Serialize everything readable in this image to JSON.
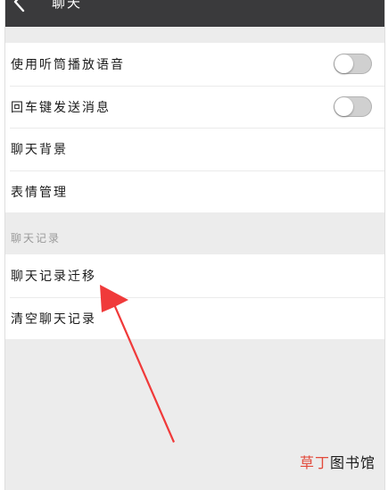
{
  "header": {
    "title": "聊天",
    "back_icon": "chevron-left-icon"
  },
  "settings": {
    "group1": [
      {
        "label": "使用听筒播放语音",
        "type": "toggle",
        "on": false
      },
      {
        "label": "回车键发送消息",
        "type": "toggle",
        "on": false
      },
      {
        "label": "聊天背景",
        "type": "link"
      },
      {
        "label": "表情管理",
        "type": "link"
      }
    ],
    "section_header": "聊天记录",
    "group2": [
      {
        "label": "聊天记录迁移",
        "type": "link"
      },
      {
        "label": "清空聊天记录",
        "type": "link"
      }
    ]
  },
  "watermark": {
    "part1": "草丁",
    "part2": "图书馆"
  },
  "colors": {
    "titlebar": "#3a3a3c",
    "background": "#ececec",
    "toggle_off": "#d0d0d0",
    "arrow": "#f03a3a",
    "watermark_accent": "#e24a3b"
  }
}
